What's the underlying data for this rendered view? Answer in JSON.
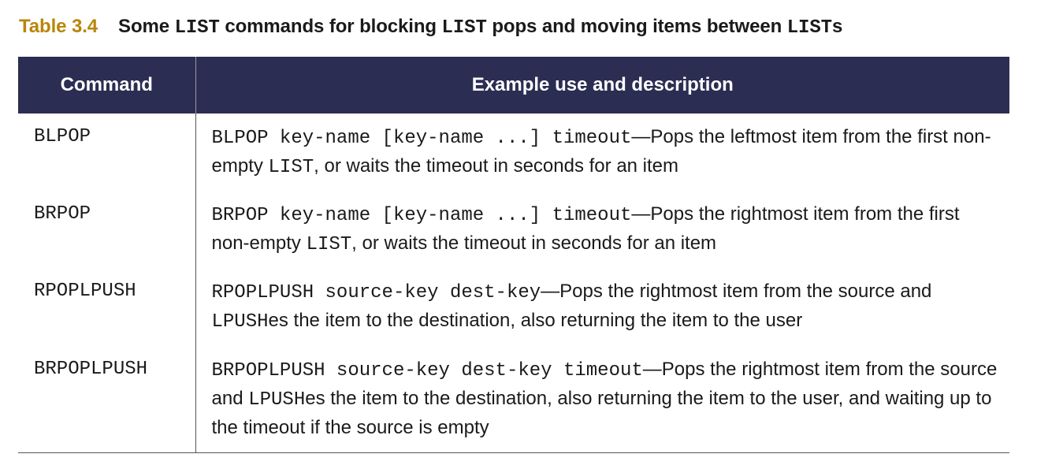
{
  "caption": {
    "number": "Table 3.4",
    "parts": [
      "Some ",
      "LIST",
      " commands for blocking ",
      "LIST",
      " pops and moving items between ",
      "LIST",
      "s"
    ]
  },
  "table": {
    "headers": [
      "Command",
      "Example use and description"
    ],
    "rows": [
      {
        "command": "BLPOP",
        "desc": [
          "BLPOP key-name [key-name ...] timeout",
          "—Pops the leftmost item from the first non-empty ",
          "LIST",
          ", or waits the timeout in seconds for an item"
        ]
      },
      {
        "command": "BRPOP",
        "desc": [
          "BRPOP key-name [key-name ...] timeout",
          "—Pops the rightmost item from the first non-empty ",
          "LIST",
          ", or waits the timeout in seconds for an item"
        ]
      },
      {
        "command": "RPOPLPUSH",
        "desc": [
          "RPOPLPUSH source-key dest-key",
          "—Pops the rightmost item from the source and ",
          "LPUSH",
          "es the item to the destination, also returning the item to the user"
        ]
      },
      {
        "command": "BRPOPLPUSH",
        "desc": [
          "BRPOPLPUSH source-key dest-key timeout",
          "—Pops the rightmost item from the source and ",
          "LPUSH",
          "es the item to the destination, also returning the item to the user, and waiting up to the timeout if the source is empty"
        ]
      }
    ]
  },
  "colors": {
    "header_bg": "#2b2d52",
    "caption_number": "#b8860b"
  }
}
